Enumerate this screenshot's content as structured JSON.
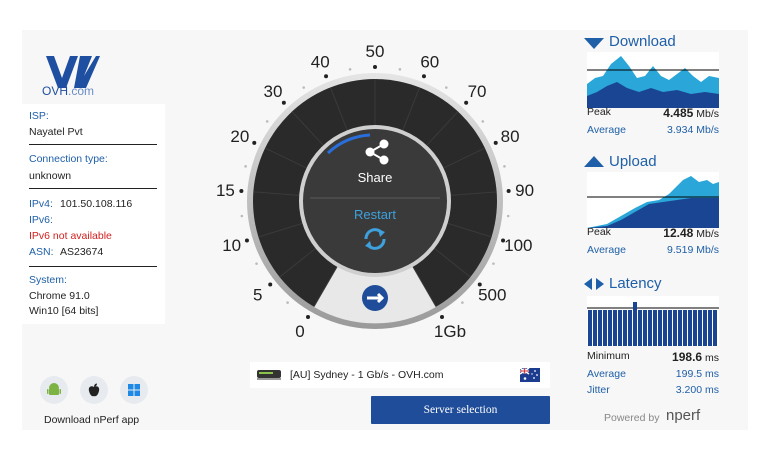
{
  "brand": {
    "logo_name": "OVH",
    "logo_suffix": ".com"
  },
  "info": {
    "isp_label": "ISP:",
    "isp_value": "Nayatel Pvt",
    "conn_label": "Connection type:",
    "conn_value": "unknown",
    "ipv4_label": "IPv4:",
    "ipv4_value": "101.50.108.116",
    "ipv6_label": "IPv6:",
    "ipv6_value": "IPv6 not available",
    "asn_label": "ASN:",
    "asn_value": "AS23674",
    "system_label": "System:",
    "system_browser": "Chrome 91.0",
    "system_os": "Win10 [64 bits]"
  },
  "apps": {
    "download_label": "Download nPerf app",
    "icons": [
      "android-icon",
      "apple-icon",
      "windows-icon"
    ]
  },
  "gauge": {
    "scale": [
      "0",
      "5",
      "10",
      "15",
      "20",
      "30",
      "40",
      "50",
      "60",
      "70",
      "80",
      "90",
      "100",
      "500",
      "1Gb"
    ],
    "share_label": "Share",
    "restart_label": "Restart"
  },
  "server": {
    "text": "[AU] Sydney - 1 Gb/s - OVH.com",
    "button": "Server selection"
  },
  "download": {
    "title": "Download",
    "peak_label": "Peak",
    "peak_value": "4.485",
    "peak_unit": "Mb/s",
    "avg_label": "Average",
    "avg_value": "3.934 Mb/s"
  },
  "upload": {
    "title": "Upload",
    "peak_label": "Peak",
    "peak_value": "12.48",
    "peak_unit": "Mb/s",
    "avg_label": "Average",
    "avg_value": "9.519 Mb/s"
  },
  "latency": {
    "title": "Latency",
    "min_label": "Minimum",
    "min_value": "198.6",
    "min_unit": "ms",
    "avg_label": "Average",
    "avg_value": "199.5 ms",
    "jitter_label": "Jitter",
    "jitter_value": "3.200 ms"
  },
  "footer": {
    "powered_label": "Powered by",
    "brand": "nperf"
  },
  "colors": {
    "accent": "#1f4d99",
    "graph_light": "#2aa7d8",
    "graph_dark": "#1a4592",
    "error": "#d21f1f"
  }
}
